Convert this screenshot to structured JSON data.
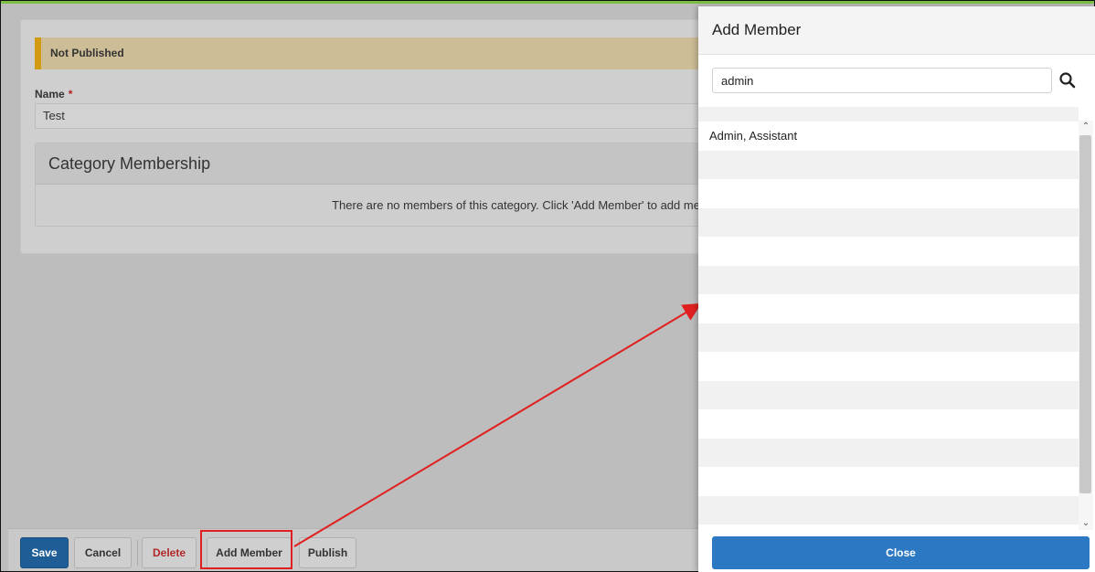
{
  "main": {
    "banner": "Not Published",
    "name_label": "Name",
    "required_mark": "*",
    "name_value": "Test",
    "membership": {
      "heading": "Category Membership",
      "empty_message": "There are no members of this category. Click 'Add Member' to add memb"
    }
  },
  "footer": {
    "save": "Save",
    "cancel": "Cancel",
    "delete": "Delete",
    "add_member": "Add Member",
    "publish": "Publish"
  },
  "side_panel": {
    "title": "Add Member",
    "search_value": "admin",
    "results": [
      "Admin, Assistant"
    ],
    "close": "Close"
  },
  "colors": {
    "primary": "#2d78c2",
    "save": "#1f5d96",
    "warning_bar": "#d19a12",
    "annotation": "#e02020"
  }
}
